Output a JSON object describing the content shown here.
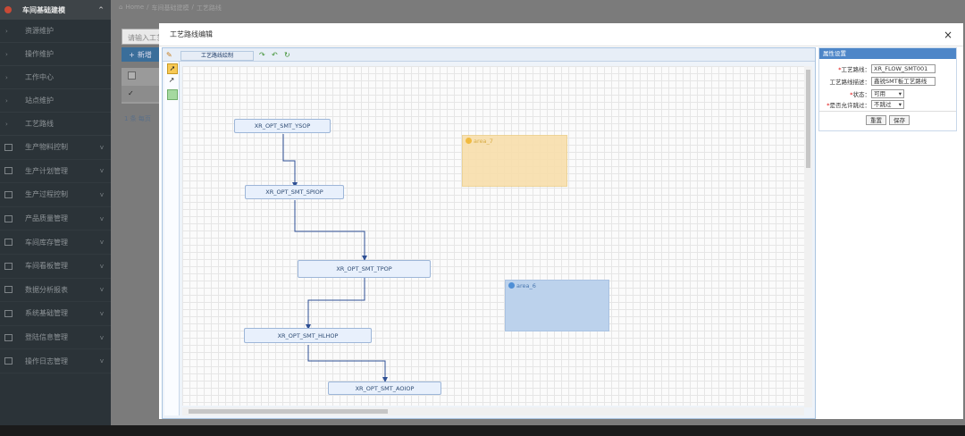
{
  "sidebar": {
    "top": {
      "label": "车间基础建模",
      "icon": "cube-icon"
    },
    "subitems": [
      {
        "label": "资源维护"
      },
      {
        "label": "操作维护"
      },
      {
        "label": "工作中心"
      },
      {
        "label": "站点维护"
      },
      {
        "label": "工艺路线"
      }
    ],
    "items": [
      {
        "label": "生产物料控制",
        "icon": "list-icon"
      },
      {
        "label": "生产计划管理",
        "icon": "calendar-icon"
      },
      {
        "label": "生产过程控制",
        "icon": "process-icon"
      },
      {
        "label": "产品质量管理",
        "icon": "quality-icon"
      },
      {
        "label": "车间库存管理",
        "icon": "stock-icon"
      },
      {
        "label": "车间看板管理",
        "icon": "board-icon"
      },
      {
        "label": "数据分析报表",
        "icon": "report-icon"
      },
      {
        "label": "系统基础管理",
        "icon": "system-icon"
      },
      {
        "label": "登陆信息管理",
        "icon": "login-icon"
      },
      {
        "label": "操作日志管理",
        "icon": "log-icon"
      }
    ]
  },
  "breadcrumb": {
    "home": "Home",
    "sep": "/",
    "level1": "车间基础建模",
    "level2": "工艺路线"
  },
  "background": {
    "search_placeholder": "请输入工艺",
    "add_label": "新增",
    "pager": "1 条 每页"
  },
  "modal": {
    "title": "工艺路线编辑",
    "close": "×",
    "designer_title": "工艺路线绘制",
    "nodes": [
      {
        "label": "XR_OPT_SMT_YSOP"
      },
      {
        "label": "XR_OPT_SMT_SPIOP"
      },
      {
        "label": "XR_OPT_SMT_TPOP"
      },
      {
        "label": "XR_OPT_SMT_HLHOP"
      },
      {
        "label": "XR_OPT_SMT_AOIOP"
      }
    ],
    "areas": [
      {
        "label": "area_7",
        "color": "#f8dfac"
      },
      {
        "label": "area_6",
        "color": "#bcd2ec"
      }
    ]
  },
  "props": {
    "header": "属性设置",
    "route_label": "工艺路线：",
    "route_value": "XR_FLOW_SMT001",
    "desc_label": "工艺路线描述：",
    "desc_value": "鑫锐SMT板工艺路线",
    "status_label": "状态：",
    "status_value": "可用",
    "skip_label": "是否允许跳过：",
    "skip_value": "不跳过",
    "reset": "重置",
    "save": "保存"
  },
  "colors": {
    "accent": "#4d86c8",
    "sidebar": "#2b3338",
    "brand": "#c94a36"
  }
}
